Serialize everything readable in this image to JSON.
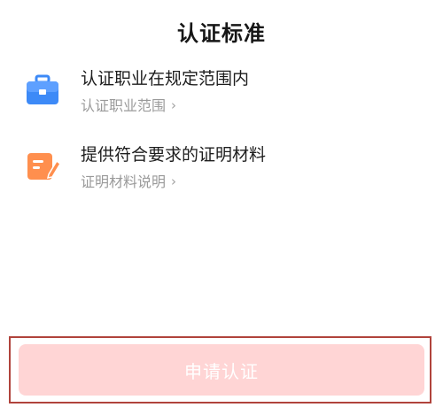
{
  "header": {
    "title": "认证标准"
  },
  "items": [
    {
      "icon": "briefcase-icon",
      "heading": "认证职业在规定范围内",
      "link_label": "认证职业范围",
      "icon_color": "#3d8af7"
    },
    {
      "icon": "document-edit-icon",
      "heading": "提供符合要求的证明材料",
      "link_label": "证明材料说明",
      "icon_color": "#ff8f4e"
    }
  ],
  "footer": {
    "apply_label": "申请认证",
    "button_color": "#ffd5d5",
    "frame_color": "#b0433c"
  }
}
